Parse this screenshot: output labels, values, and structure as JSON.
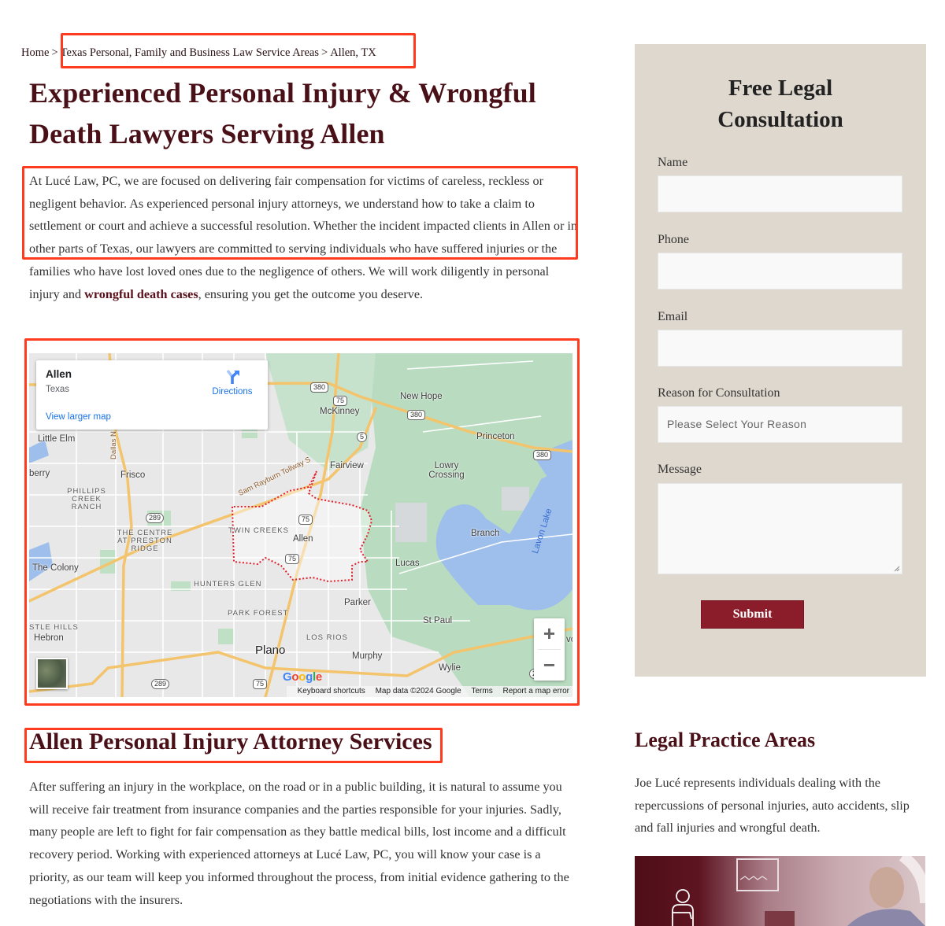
{
  "breadcrumb": {
    "items": [
      "Home",
      "Texas Personal, Family and Business Law Service Areas",
      "Allen, TX"
    ],
    "separator": ">"
  },
  "page_title": "Experienced Personal Injury & Wrongful Death Lawyers Serving Allen",
  "intro": {
    "before_link": "At Lucé Law, PC, we are focused on delivering fair compensation for victims of careless, reckless or negligent behavior. As experienced personal injury attorneys, we understand how to take a claim to settlement or court and achieve a successful resolution. Whether the incident impacted clients in Allen or in other parts of Texas, our lawyers are committed to serving individuals who have suffered injuries or the families who have lost loved ones due to the negligence of others. We will work diligently in personal injury and ",
    "link_text": "wrongful death cases",
    "after_link": ", ensuring you get the outcome you deserve."
  },
  "map": {
    "card": {
      "place": "Allen",
      "region": "Texas",
      "directions_label": "Directions",
      "view_larger_label": "View larger map"
    },
    "labels": {
      "mckinney": "McKinney",
      "new_hope": "New Hope",
      "princeton": "Princeton",
      "little_elm": "Little Elm",
      "frisco": "Frisco",
      "fairview": "Fairview",
      "lowry_crossing": "Lowry Crossing",
      "berry": "berry",
      "phillips_creek_ranch": "PHILLIPS CREEK RANCH",
      "centre_preston_ridge": "THE CENTRE AT PRESTON RIDGE",
      "twin_creeks": "TWIN CREEKS",
      "allen": "Allen",
      "branch": "Branch",
      "lavon_lake": "Lavon Lake",
      "the_colony": "The Colony",
      "lucas": "Lucas",
      "hunters_glen": "HUNTERS GLEN",
      "parker": "Parker",
      "park_forest": "PARK FOREST",
      "castle_hills": "STLE HILLS",
      "hebron": "Hebron",
      "st_paul": "St Paul",
      "los_rios": "LOS RIOS",
      "plano": "Plano",
      "murphy": "Murphy",
      "wylie": "Wylie",
      "sam_rayburn": "Sam Rayburn Tollway S",
      "dallas_north": "Dallas N",
      "wylie_edge": "vo"
    },
    "shields": {
      "us380_a": "380",
      "us380_b": "380",
      "us380_c": "380",
      "us75_a": "75",
      "us75_b": "75",
      "us75_c": "75",
      "us75_d": "75",
      "sh5": "5",
      "sh289_a": "289",
      "sh289_b": "289",
      "edge": "2"
    },
    "zoom_in": "+",
    "zoom_out": "−",
    "google_logo": [
      "G",
      "o",
      "o",
      "g",
      "l",
      "e"
    ],
    "google_colors": [
      "#4285F4",
      "#EA4335",
      "#FBBC05",
      "#4285F4",
      "#34A853",
      "#EA4335"
    ],
    "attribution": [
      "Keyboard shortcuts",
      "Map data ©2024 Google",
      "Terms",
      "Report a map error"
    ]
  },
  "services": {
    "title": "Allen Personal Injury Attorney Services",
    "body": "After suffering an injury in the workplace, on the road or in a public building, it is natural to assume you will receive fair treatment from insurance companies and the parties responsible for your injuries. Sadly, many people are left to fight for fair compensation as they battle medical bills, lost income and a difficult recovery period. Working with experienced attorneys at Lucé Law, PC, you will know your case is a priority, as our team will keep you informed throughout the process, from initial evidence gathering to the negotiations with the insurers."
  },
  "form": {
    "title": "Free Legal Consultation",
    "fields": {
      "name_label": "Name",
      "name_value": "",
      "phone_label": "Phone",
      "phone_value": "",
      "email_label": "Email",
      "email_value": "",
      "reason_label": "Reason for Consultation",
      "reason_selected": "Please Select Your Reason",
      "message_label": "Message",
      "message_value": ""
    },
    "submit_label": "Submit"
  },
  "practice": {
    "title": "Legal Practice Areas",
    "body": "Joe Lucé represents individuals dealing with the repercussions of personal injuries, auto accidents, slip and fall injuries and wrongful death."
  },
  "colors": {
    "brand_maroon": "#4a1018",
    "button_red": "#8b1c2a",
    "panel_beige": "#dfd8ce",
    "annotation_red": "#ff3b1f",
    "map_link_blue": "#1a73e8"
  }
}
